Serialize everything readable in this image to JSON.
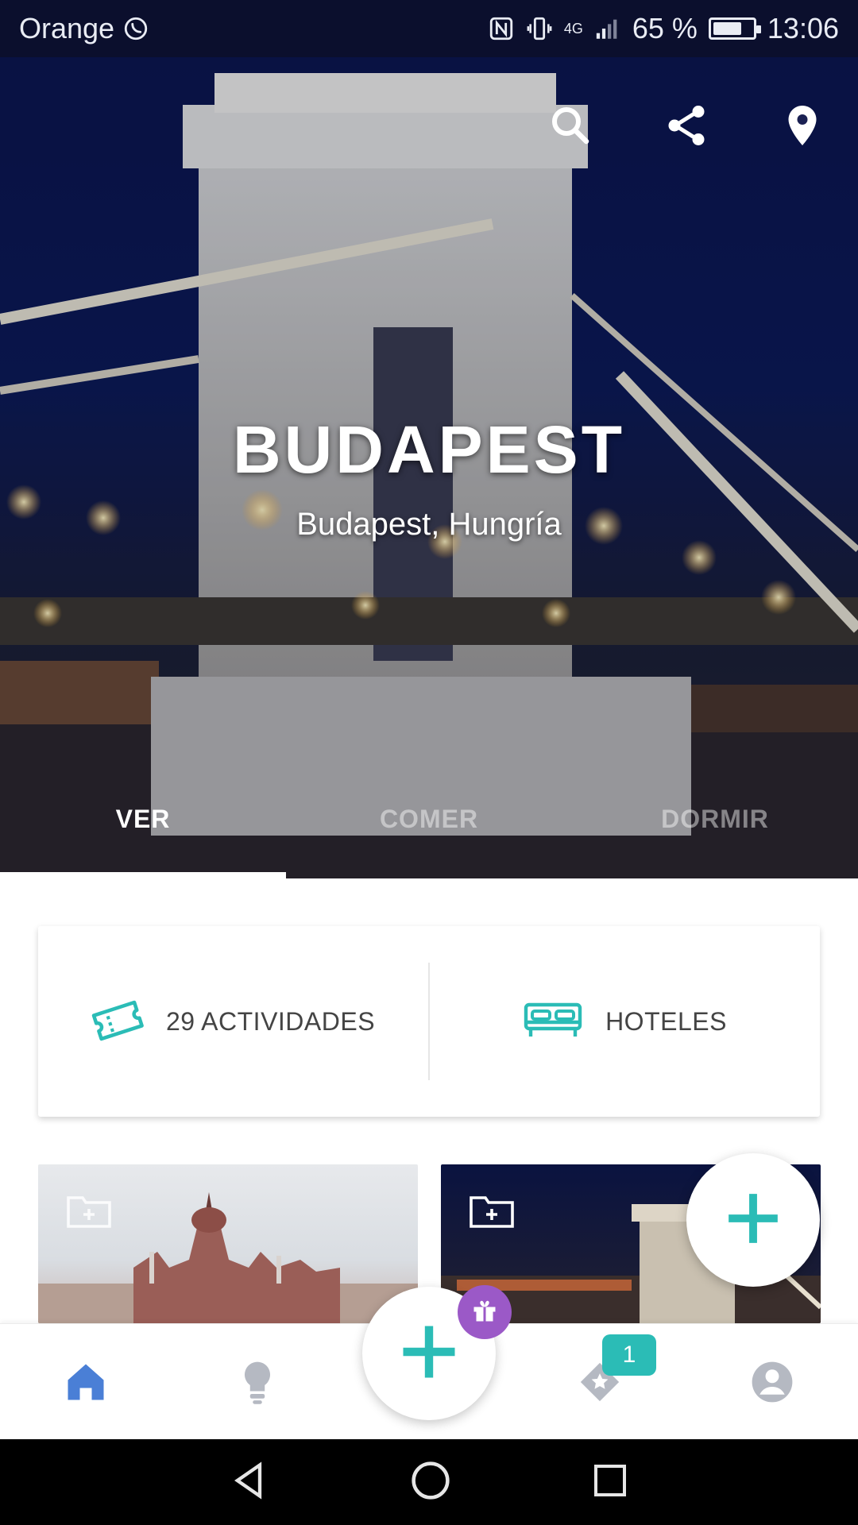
{
  "status_bar": {
    "carrier": "Orange",
    "network": "4G",
    "battery_percent": "65 %",
    "battery_level": 0.65,
    "time": "13:06"
  },
  "hero": {
    "title": "BUDAPEST",
    "subtitle": "Budapest, Hungría",
    "actions": [
      "search-icon",
      "share-icon",
      "location-pin-icon"
    ],
    "tabs": [
      {
        "label": "VER",
        "active": true
      },
      {
        "label": "COMER",
        "active": false
      },
      {
        "label": "DORMIR",
        "active": false
      }
    ]
  },
  "summary_card": {
    "activities_label": "29 ACTIVIDADES",
    "hotels_label": "HOTELES",
    "activities_icon": "ticket-icon",
    "hotels_icon": "bed-icon"
  },
  "thumbnails": [
    {
      "icon": "folder-add-icon"
    },
    {
      "icon": "folder-add-icon"
    }
  ],
  "bottom_nav": {
    "items": [
      "home-icon",
      "lightbulb-icon",
      "add-icon",
      "favorites-icon",
      "profile-icon"
    ],
    "favorites_badge": "1"
  },
  "colors": {
    "accent": "#2bbcb6",
    "nav_active": "#4a7fd6",
    "nav_inactive": "#b5b9c2",
    "gift_badge": "#9b59c7",
    "status_bar_bg": "#0b0f2d"
  }
}
